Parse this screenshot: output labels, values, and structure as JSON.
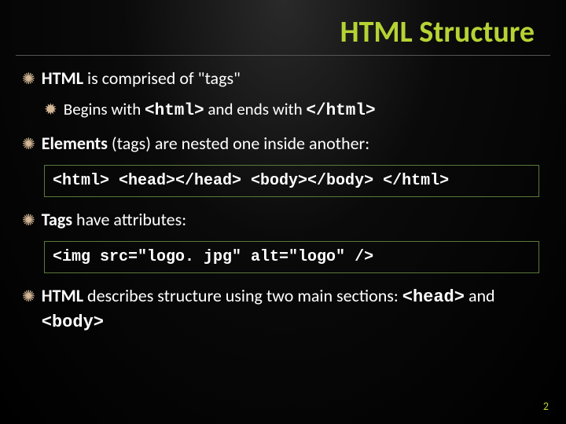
{
  "title": "HTML Structure",
  "bullets": {
    "b1": {
      "prefix": "HTML",
      "rest": " is comprised of \"tags\""
    },
    "b1a": {
      "text_before": "Begins with ",
      "code1": "<html>",
      "mid": " and ends with ",
      "code2": "</html>"
    },
    "b2": {
      "prefix": "Elements",
      "rest": " (tags) are nested one inside another:"
    },
    "code1": "<html> <head></head> <body></body> </html>",
    "b3": {
      "prefix": "Tags",
      "rest": " have attributes:"
    },
    "code2": "<img src=\"logo. jpg\" alt=\"logo\" />",
    "b4": {
      "prefix": "HTML",
      "mid1": " describes structure using two main sections: ",
      "code1": "<head>",
      "mid2": " and ",
      "code2": "<body>"
    }
  },
  "pagenum": "2"
}
